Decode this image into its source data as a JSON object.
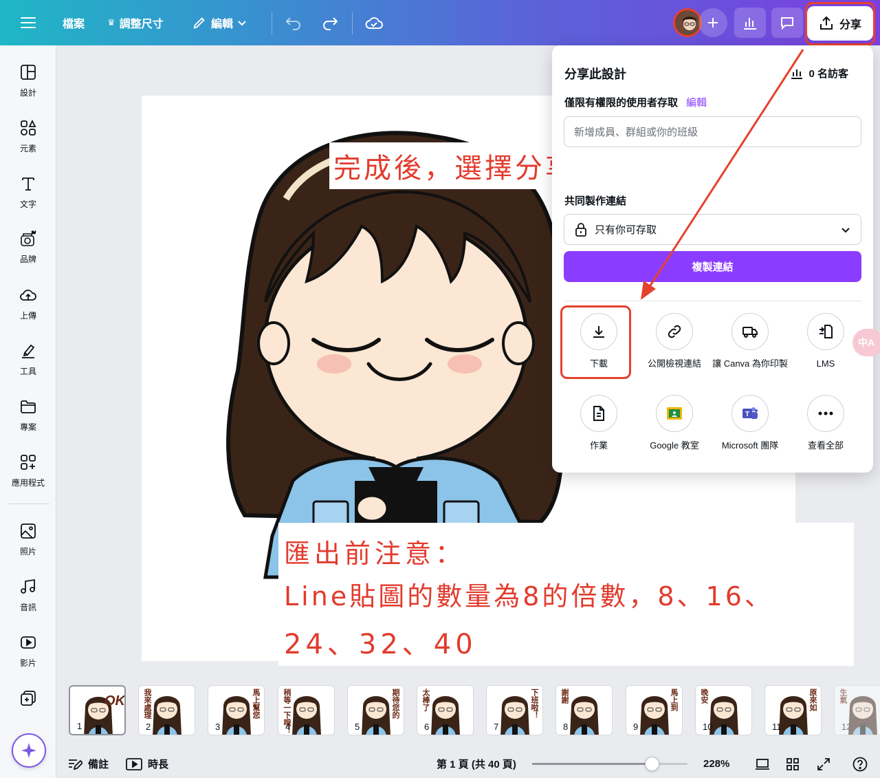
{
  "topbar": {
    "file_label": "檔案",
    "resize_label": "調整尺寸",
    "edit_label": "編輯",
    "share_label": "分享"
  },
  "sidebar": {
    "items": [
      {
        "label": "設計",
        "icon": "layout-icon"
      },
      {
        "label": "元素",
        "icon": "shapes-icon"
      },
      {
        "label": "文字",
        "icon": "text-icon"
      },
      {
        "label": "品牌",
        "icon": "brand-icon"
      },
      {
        "label": "上傳",
        "icon": "upload-cloud-icon"
      },
      {
        "label": "工具",
        "icon": "pen-tool-icon"
      },
      {
        "label": "專案",
        "icon": "folder-icon"
      },
      {
        "label": "應用程式",
        "icon": "apps-icon"
      },
      {
        "label": "照片",
        "icon": "photo-icon"
      },
      {
        "label": "音訊",
        "icon": "music-icon"
      },
      {
        "label": "影片",
        "icon": "video-icon"
      }
    ]
  },
  "notes": {
    "top": "完成後，選擇分享➡️下載",
    "bottom_line1": "匯出前注意：",
    "bottom_line2": "Line貼圖的數量為8的倍數，8、16、",
    "bottom_line3": "24、32、40"
  },
  "share_panel": {
    "title": "分享此設計",
    "visitors": "0 名訪客",
    "access_label": "僅限有權限的使用者存取",
    "access_edit": "編輯",
    "input_placeholder": "新增成員、群組或你的班級",
    "collab_label": "共同製作連結",
    "select_value": "只有你可存取",
    "copy_button": "複製連結",
    "options": [
      {
        "label": "下載",
        "icon": "download-icon"
      },
      {
        "label": "公開檢視連結",
        "icon": "link-icon"
      },
      {
        "label": "讓 Canva 為你印製",
        "icon": "truck-icon"
      },
      {
        "label": "LMS",
        "icon": "lms-icon"
      },
      {
        "label": "作業",
        "icon": "document-icon"
      },
      {
        "label": "Google 教室",
        "icon": "google-classroom-icon"
      },
      {
        "label": "Microsoft 團隊",
        "icon": "teams-icon"
      },
      {
        "label": "查看全部",
        "icon": "more-icon"
      }
    ]
  },
  "thumbnails": [
    {
      "num": "1",
      "text": "OK"
    },
    {
      "num": "2",
      "text": "我來處理"
    },
    {
      "num": "3",
      "text": "馬上幫您"
    },
    {
      "num": "4",
      "text": "稍等一下哦！"
    },
    {
      "num": "5",
      "text": "期待您的"
    },
    {
      "num": "6",
      "text": "太棒了"
    },
    {
      "num": "7",
      "text": "下班啦！"
    },
    {
      "num": "8",
      "text": "謝謝"
    },
    {
      "num": "9",
      "text": "馬上到"
    },
    {
      "num": "10",
      "text": "晚安"
    },
    {
      "num": "11",
      "text": "原來如"
    },
    {
      "num": "12",
      "text": "生氣"
    }
  ],
  "bottombar": {
    "notes_label": "備註",
    "duration_label": "時長",
    "page_info": "第 1 頁 (共 40 頁)",
    "zoom": "228%",
    "zoom_fraction": 0.77
  },
  "colors": {
    "accent": "#8b3dff",
    "annotation_red": "#e23b2d"
  }
}
